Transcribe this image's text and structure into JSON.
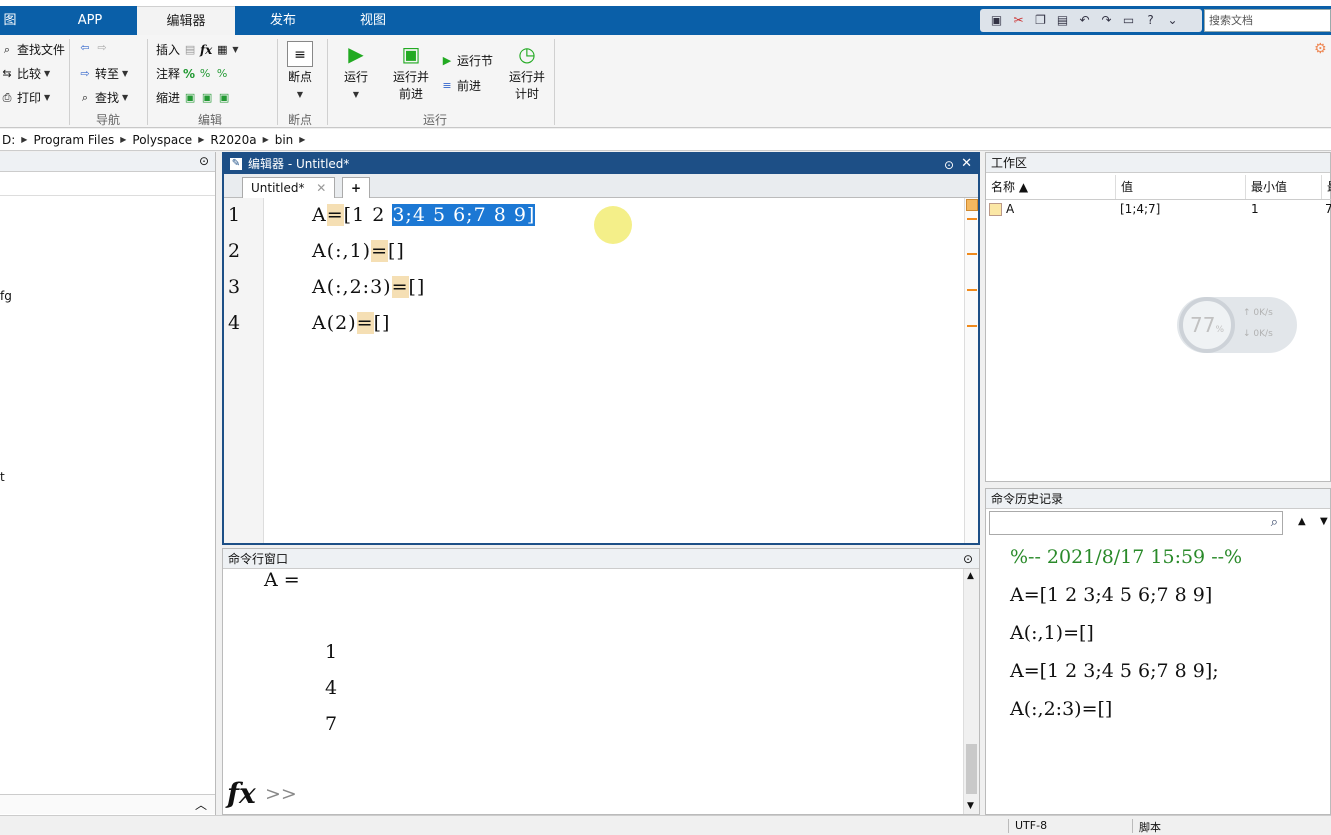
{
  "tabs": [
    {
      "label": "图"
    },
    {
      "label": "APP"
    },
    {
      "label": "编辑器"
    },
    {
      "label": "发布"
    },
    {
      "label": "视图"
    }
  ],
  "search_placeholder": "搜索文档",
  "ribbon": {
    "nav": {
      "find_files": "查找文件",
      "compare": "比较",
      "print": "打印",
      "goto": "转至",
      "find": "查找",
      "label": "导航"
    },
    "edit": {
      "insert": "插入",
      "comment": "注释",
      "indent": "缩进",
      "label": "编辑",
      "fx": "fx",
      "percent": "%"
    },
    "breakpoints": {
      "btn": "断点",
      "label": "断点"
    },
    "run": {
      "run": "运行",
      "run_advance_1": "运行并",
      "run_advance_2": "前进",
      "run_section": "运行节",
      "advance": "前进",
      "run_time_1": "运行并",
      "run_time_2": "计时",
      "label": "运行"
    }
  },
  "address": [
    "D:",
    "Program Files",
    "Polyspace",
    "R2020a",
    "bin"
  ],
  "left_panel": {
    "item1": "fg",
    "item2": "t"
  },
  "editor": {
    "title": "编辑器 - Untitled*",
    "tab": "Untitled*",
    "add_tab": "+",
    "line_numbers": [
      "1",
      "2",
      "3",
      "4"
    ],
    "lines": {
      "l1_pre": "A",
      "l1_eq": "=",
      "l1_mid": "[1 2 ",
      "l1_sel": "3;4 5 6;7 8 9]",
      "l2_pre": "A(:,1)",
      "l2_eq": "=",
      "l2_post": "[]",
      "l3_pre": "A(:,2:3)",
      "l3_eq": "=",
      "l3_post": "[]",
      "l4_pre": "A(2)",
      "l4_eq": "=",
      "l4_post": "[]"
    }
  },
  "command_window": {
    "title": "命令行窗口",
    "output_label": "A =",
    "values": [
      "1",
      "4",
      "7"
    ],
    "fx": "fx",
    "prompt": ">>"
  },
  "workspace": {
    "title": "工作区",
    "columns": [
      "名称 ▲",
      "值",
      "最小值",
      "最"
    ],
    "rows": [
      {
        "name": "A",
        "value": "[1;4;7]",
        "min": "1",
        "max": "7"
      }
    ]
  },
  "history": {
    "title": "命令历史记录",
    "lines": [
      "%-- 2021/8/17 15:59 --%",
      "A=[1 2 3;4 5 6;7 8 9]",
      "A(:,1)=[]",
      "A=[1 2 3;4 5 6;7 8 9];",
      "A(:,2:3)=[]"
    ]
  },
  "speed_widget": {
    "percent": "77",
    "unit": "%",
    "up": "0K/s",
    "down": "0K/s"
  },
  "status": {
    "encoding": "UTF-8",
    "type": "脚本"
  },
  "colors": {
    "tab_bar": "#0a5fa8",
    "selection": "#1c78d4",
    "highlight": "#f5dfb4",
    "editor_border": "#1d4f86"
  }
}
